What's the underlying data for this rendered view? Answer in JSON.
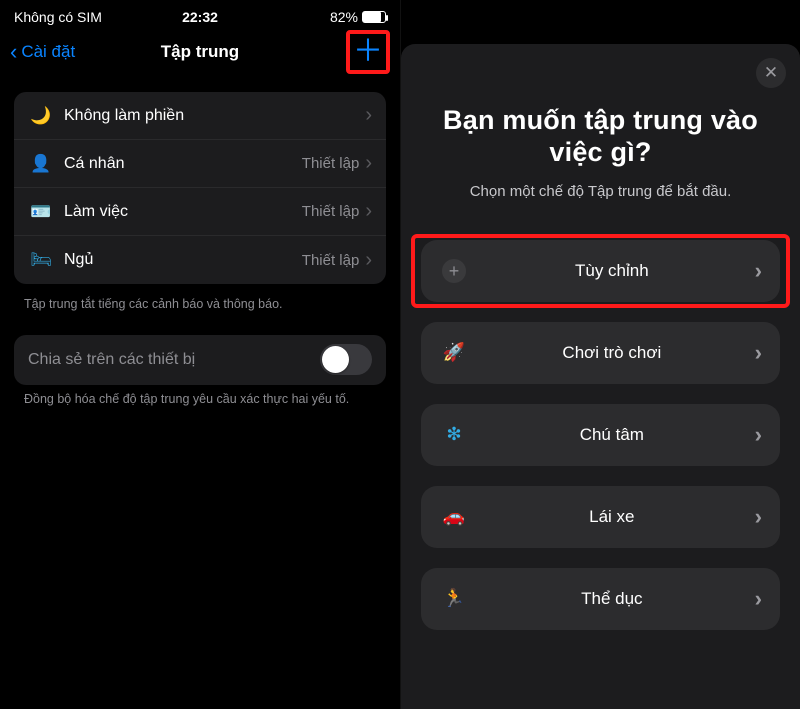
{
  "status": {
    "carrier": "Không có SIM",
    "time": "22:32",
    "battery_pct": "82%"
  },
  "left": {
    "back_label": "Cài đặt",
    "title": "Tập trung",
    "modes": [
      {
        "icon": "🌙",
        "icon_name": "moon-icon",
        "icon_class": "c-indigo",
        "label": "Không làm phiền",
        "detail": ""
      },
      {
        "icon": "👤",
        "icon_name": "person-icon",
        "icon_class": "c-purple",
        "label": "Cá nhân",
        "detail": "Thiết lập"
      },
      {
        "icon": "🪪",
        "icon_name": "badge-icon",
        "icon_class": "c-teal2",
        "label": "Làm việc",
        "detail": "Thiết lập"
      },
      {
        "icon": "🛏",
        "icon_name": "bed-icon",
        "icon_class": "c-teal2",
        "label": "Ngủ",
        "detail": "Thiết lập"
      }
    ],
    "foot1": "Tập trung tắt tiếng các cảnh báo và thông báo.",
    "share_label": "Chia sẻ trên các thiết bị",
    "foot2": "Đồng bộ hóa chế độ tập trung yêu cầu xác thực hai yếu tố."
  },
  "right": {
    "heading": "Bạn muốn tập trung vào việc gì?",
    "sub": "Chọn một chế độ Tập trung để bắt đầu.",
    "options": [
      {
        "icon": "+",
        "icon_name": "plus-circle-icon",
        "icon_class": "",
        "label": "Tùy chỉnh",
        "highlight": true,
        "plus": true
      },
      {
        "icon": "🚀",
        "icon_name": "rocket-icon",
        "icon_class": "c-blue",
        "label": "Chơi trò chơi",
        "highlight": false,
        "plus": false
      },
      {
        "icon": "❇︎",
        "icon_name": "mindfulness-icon",
        "icon_class": "c-teal2",
        "label": "Chú tâm",
        "highlight": false,
        "plus": false
      },
      {
        "icon": "🚗",
        "icon_name": "car-icon",
        "icon_class": "c-indigo",
        "label": "Lái xe",
        "highlight": false,
        "plus": false
      },
      {
        "icon": "🏃",
        "icon_name": "running-icon",
        "icon_class": "c-green",
        "label": "Thể dục",
        "highlight": false,
        "plus": false
      }
    ]
  }
}
